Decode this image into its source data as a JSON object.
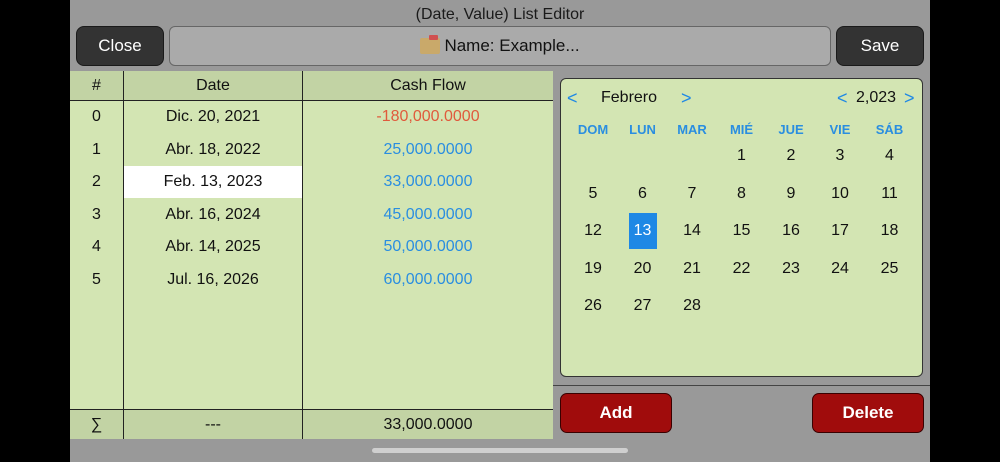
{
  "window": {
    "title": "(Date, Value) List Editor"
  },
  "toolbar": {
    "close_label": "Close",
    "save_label": "Save",
    "name_text": "Name: Example..."
  },
  "table": {
    "headers": [
      "#",
      "Date",
      "Cash Flow"
    ],
    "rows": [
      {
        "index": "0",
        "date": "Dic. 20, 2021",
        "value": "-180,000.0000"
      },
      {
        "index": "1",
        "date": "Abr. 18, 2022",
        "value": "25,000.0000"
      },
      {
        "index": "2",
        "date": "Feb. 13, 2023",
        "value": "33,000.0000"
      },
      {
        "index": "3",
        "date": "Abr. 16, 2024",
        "value": "45,000.0000"
      },
      {
        "index": "4",
        "date": "Abr. 14, 2025",
        "value": "50,000.0000"
      },
      {
        "index": "5",
        "date": "Jul. 16, 2026",
        "value": "60,000.0000"
      }
    ],
    "selected_row": 2,
    "footer": {
      "symbol": "∑",
      "date": "---",
      "value": "33,000.0000"
    }
  },
  "calendar": {
    "month": "Febrero",
    "year": "2,023",
    "prev": "<",
    "next": ">",
    "weekdays": [
      "DOM",
      "LUN",
      "MAR",
      "MIÉ",
      "JUE",
      "VIE",
      "SÁB"
    ],
    "weeks": [
      [
        "",
        "",
        "",
        "1",
        "2",
        "3",
        "4"
      ],
      [
        "5",
        "6",
        "7",
        "8",
        "9",
        "10",
        "11"
      ],
      [
        "12",
        "13",
        "14",
        "15",
        "16",
        "17",
        "18"
      ],
      [
        "19",
        "20",
        "21",
        "22",
        "23",
        "24",
        "25"
      ],
      [
        "26",
        "27",
        "28",
        "",
        "",
        "",
        ""
      ]
    ],
    "selected_day": "13"
  },
  "actions": {
    "add_label": "Add",
    "delete_label": "Delete"
  },
  "colors": {
    "negative": "#e05a3c",
    "positive": "#2a8ee0",
    "accent": "#1e88e5",
    "danger": "#a00c0c"
  }
}
